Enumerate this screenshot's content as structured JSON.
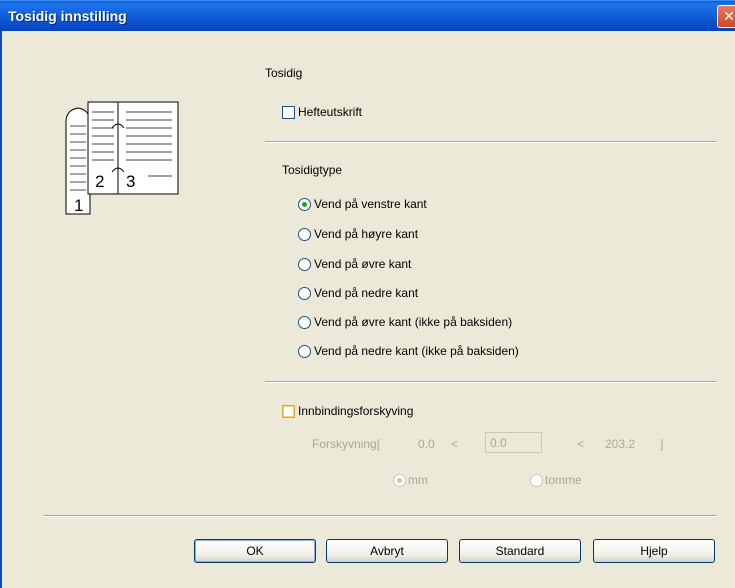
{
  "window": {
    "title": "Tosidig innstilling",
    "close_glyph": "✕"
  },
  "duplex": {
    "section_label": "Tosidig",
    "booklet_label": "Hefteutskrift",
    "booklet_checked": false
  },
  "duplex_type": {
    "label": "Tosidigtype",
    "options": [
      {
        "label": "Vend på venstre kant",
        "checked": true
      },
      {
        "label": "Vend på høyre kant",
        "checked": false
      },
      {
        "label": "Vend på øvre kant",
        "checked": false
      },
      {
        "label": "Vend på nedre kant",
        "checked": false
      },
      {
        "label": "Vend på øvre kant (ikke på baksiden)",
        "checked": false
      },
      {
        "label": "Vend på nedre kant (ikke på baksiden)",
        "checked": false
      }
    ]
  },
  "binding_offset": {
    "label": "Innbindingsforskyving",
    "checked": false,
    "offset_label": "Forskyvning[",
    "min_value": "0.0",
    "lt1": "<",
    "value": "0.0",
    "lt2": "<",
    "max_value": "203.2",
    "close_bracket": "]",
    "units": [
      {
        "label": "mm",
        "checked": true
      },
      {
        "label": "tomme",
        "checked": false
      }
    ]
  },
  "illustration": {
    "page_numbers": [
      "1",
      "2",
      "3"
    ]
  },
  "buttons": {
    "ok": "OK",
    "cancel": "Avbryt",
    "default": "Standard",
    "help": "Hjelp"
  }
}
